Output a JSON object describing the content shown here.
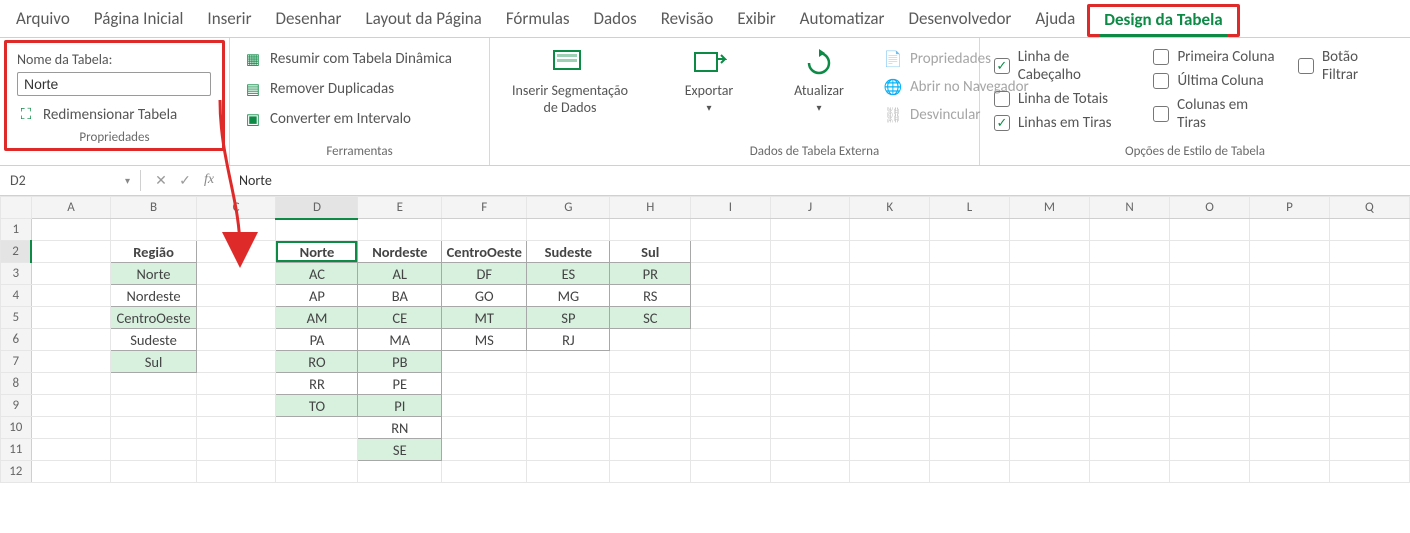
{
  "tabs": [
    "Arquivo",
    "Página Inicial",
    "Inserir",
    "Desenhar",
    "Layout da Página",
    "Fórmulas",
    "Dados",
    "Revisão",
    "Exibir",
    "Automatizar",
    "Desenvolvedor",
    "Ajuda",
    "Design da Tabela"
  ],
  "active_tab_index": 12,
  "ribbon": {
    "props": {
      "table_name_label": "Nome da Tabela:",
      "table_name_value": "Norte",
      "resize": "Redimensionar Tabela",
      "group_title": "Propriedades"
    },
    "tools": {
      "pivot": "Resumir com Tabela Dinâmica",
      "dedup": "Remover Duplicadas",
      "convert": "Converter em Intervalo",
      "group_title": "Ferramentas"
    },
    "slicer": {
      "label": "Inserir Segmentação\nde Dados"
    },
    "ext": {
      "export": "Exportar",
      "refresh": "Atualizar",
      "properties": "Propriedades",
      "open_browser": "Abrir no Navegador",
      "unlink": "Desvincular",
      "group_title": "Dados de Tabela Externa"
    },
    "styleopts": {
      "header_row": "Linha de Cabeçalho",
      "total_row": "Linha de Totais",
      "banded_rows": "Linhas em Tiras",
      "first_col": "Primeira Coluna",
      "last_col": "Última Coluna",
      "banded_cols": "Colunas em Tiras",
      "filter_btn": "Botão Filtrar",
      "group_title": "Opções de Estilo de Tabela",
      "checked": {
        "header_row": true,
        "total_row": false,
        "banded_rows": true,
        "first_col": false,
        "last_col": false,
        "banded_cols": false,
        "filter_btn": false
      }
    }
  },
  "formula_bar": {
    "name_box": "D2",
    "value": "Norte"
  },
  "grid": {
    "columns": [
      "A",
      "B",
      "C",
      "D",
      "E",
      "F",
      "G",
      "H",
      "I",
      "J",
      "K",
      "L",
      "M",
      "N",
      "O",
      "P",
      "Q"
    ],
    "rows": [
      1,
      2,
      3,
      4,
      5,
      6,
      7,
      8,
      9,
      10,
      11,
      12
    ],
    "active_cell": "D2"
  },
  "table_regiao": {
    "header": "Região",
    "rows": [
      "Norte",
      "Nordeste",
      "CentroOeste",
      "Sudeste",
      "Sul"
    ]
  },
  "table_main": {
    "headers": [
      "Norte",
      "Nordeste",
      "CentroOeste",
      "Sudeste",
      "Sul"
    ],
    "rows": [
      [
        "AC",
        "AL",
        "DF",
        "ES",
        "PR"
      ],
      [
        "AP",
        "BA",
        "GO",
        "MG",
        "RS"
      ],
      [
        "AM",
        "CE",
        "MT",
        "SP",
        "SC"
      ],
      [
        "PA",
        "MA",
        "MS",
        "RJ",
        ""
      ],
      [
        "RO",
        "PB",
        "",
        "",
        ""
      ],
      [
        "RR",
        "PE",
        "",
        "",
        ""
      ],
      [
        "TO",
        "PI",
        "",
        "",
        ""
      ],
      [
        "",
        "RN",
        "",
        "",
        ""
      ],
      [
        "",
        "SE",
        "",
        "",
        ""
      ]
    ]
  },
  "chart_data": null
}
